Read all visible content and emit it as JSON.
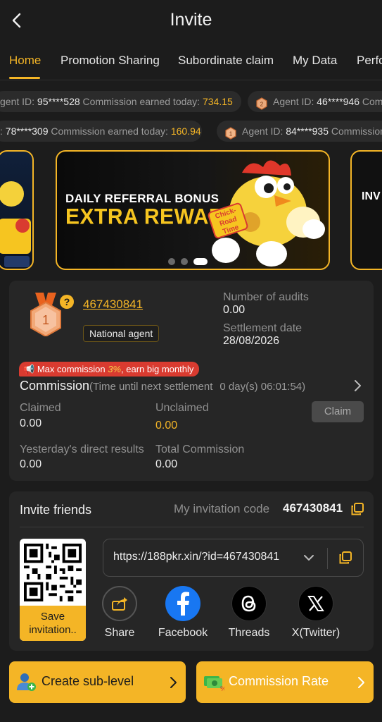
{
  "header": {
    "title": "Invite"
  },
  "tabs": [
    {
      "label": "Home",
      "active": true
    },
    {
      "label": "Promotion Sharing",
      "active": false
    },
    {
      "label": "Subordinate claim",
      "active": false
    },
    {
      "label": "My Data",
      "active": false
    },
    {
      "label": "Perfo",
      "active": false
    }
  ],
  "ticker": {
    "row1": [
      {
        "prefix": "gent ID: ",
        "id": "95****528",
        "mid": " Commission earned today: ",
        "amount": "734.15"
      },
      {
        "rank": "2",
        "prefix": "Agent ID: ",
        "id": "46****946",
        "mid": " Com",
        "amount": ""
      }
    ],
    "row2": [
      {
        "prefix": ": ",
        "id": "78****309",
        "mid": " Commission earned today: ",
        "amount": "160.94"
      },
      {
        "rank": "1",
        "prefix": "Agent ID: ",
        "id": "84****935",
        "mid": " Commission",
        "amount": ""
      }
    ]
  },
  "banner": {
    "subtitle": "DAILY REFERRAL BONUS",
    "headline": "EXTRA REWARDS",
    "logo_text": "Chick-Road Time",
    "right_peek": "INV RS PER",
    "active_slide": 3,
    "slide_count": 3
  },
  "agent": {
    "rank": "1",
    "user_id": "467430841",
    "level_badge": "National agent",
    "audits_label": "Number of audits",
    "audits_value": "0.00",
    "settlement_label": "Settlement date",
    "settlement_value": "28/08/2026"
  },
  "commission": {
    "promo_prefix": "Max commission ",
    "promo_pct": "3%",
    "promo_suffix": ", earn big monthly",
    "title": "Commission",
    "countdown_label": "(Time until next settlement",
    "countdown_value": "0 day(s) 06:01:54)",
    "claimed_label": "Claimed",
    "claimed_value": "0.00",
    "unclaimed_label": "Unclaimed",
    "unclaimed_value": "0.00",
    "claim_button": "Claim",
    "yesterday_label": "Yesterday's direct results",
    "yesterday_value": "0.00",
    "total_label": "Total Commission",
    "total_value": "0.00"
  },
  "invite": {
    "title": "Invite friends",
    "code_label": "My invitation code",
    "code_value": "467430841",
    "save_label": "Save\ninvitation..",
    "link": "https://188pkr.xin/?id=467430841",
    "share": [
      {
        "label": "Share",
        "icon": "share-icon"
      },
      {
        "label": "Facebook",
        "icon": "facebook-icon"
      },
      {
        "label": "Threads",
        "icon": "threads-icon"
      },
      {
        "label": "X(Twitter)",
        "icon": "x-twitter-icon"
      }
    ]
  },
  "actions": {
    "sub_level": "Create sub-level",
    "commission_rate": "Commission Rate"
  },
  "colors": {
    "accent": "#f4b526",
    "background": "#1c1c1c",
    "card": "#262626",
    "promo": "#d93b30"
  }
}
